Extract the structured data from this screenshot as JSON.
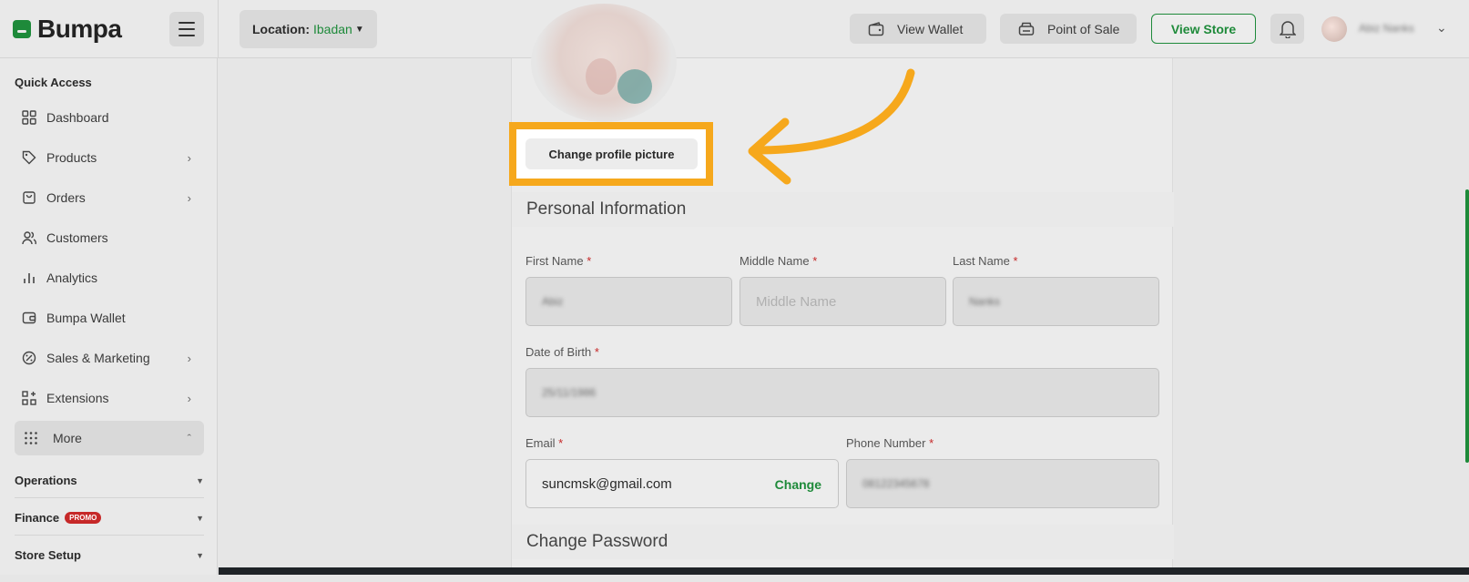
{
  "app": {
    "brand": "Bumpa"
  },
  "header": {
    "location_label": "Location:",
    "location_value": "Ibadan",
    "wallet_label": "View Wallet",
    "pos_label": "Point of Sale",
    "store_label": "View Store",
    "user_name": "Abiz Nanks"
  },
  "sidebar": {
    "quick_access": "Quick Access",
    "items": [
      {
        "label": "Dashboard",
        "icon": "grid-icon"
      },
      {
        "label": "Products",
        "icon": "tag-icon"
      },
      {
        "label": "Orders",
        "icon": "bag-icon"
      },
      {
        "label": "Customers",
        "icon": "users-icon"
      },
      {
        "label": "Analytics",
        "icon": "bar-chart-icon"
      },
      {
        "label": "Bumpa Wallet",
        "icon": "wallet-icon"
      },
      {
        "label": "Sales & Marketing",
        "icon": "percent-icon"
      },
      {
        "label": "Extensions",
        "icon": "extensions-icon"
      },
      {
        "label": "More",
        "icon": "dots-grid-icon"
      }
    ],
    "sections": {
      "operations": "Operations",
      "finance": "Finance",
      "promo": "PROMO",
      "store_setup": "Store Setup"
    }
  },
  "profile": {
    "change_picture_label": "Change profile picture",
    "personal_info_title": "Personal Information",
    "first_name_label": "First Name",
    "first_name_value": "Abiz",
    "middle_name_label": "Middle Name",
    "middle_name_placeholder": "Middle Name",
    "last_name_label": "Last Name",
    "last_name_value": "Nanks",
    "dob_label": "Date of Birth",
    "dob_value": "25/11/1986",
    "email_label": "Email",
    "email_value": "suncmsk@gmail.com",
    "email_change_label": "Change",
    "phone_label": "Phone Number",
    "phone_value": "08122345678",
    "change_password_title": "Change Password"
  },
  "colors": {
    "brand_green": "#1e8a3a",
    "highlight_orange": "#f6a81c",
    "required_red": "#c62828"
  }
}
